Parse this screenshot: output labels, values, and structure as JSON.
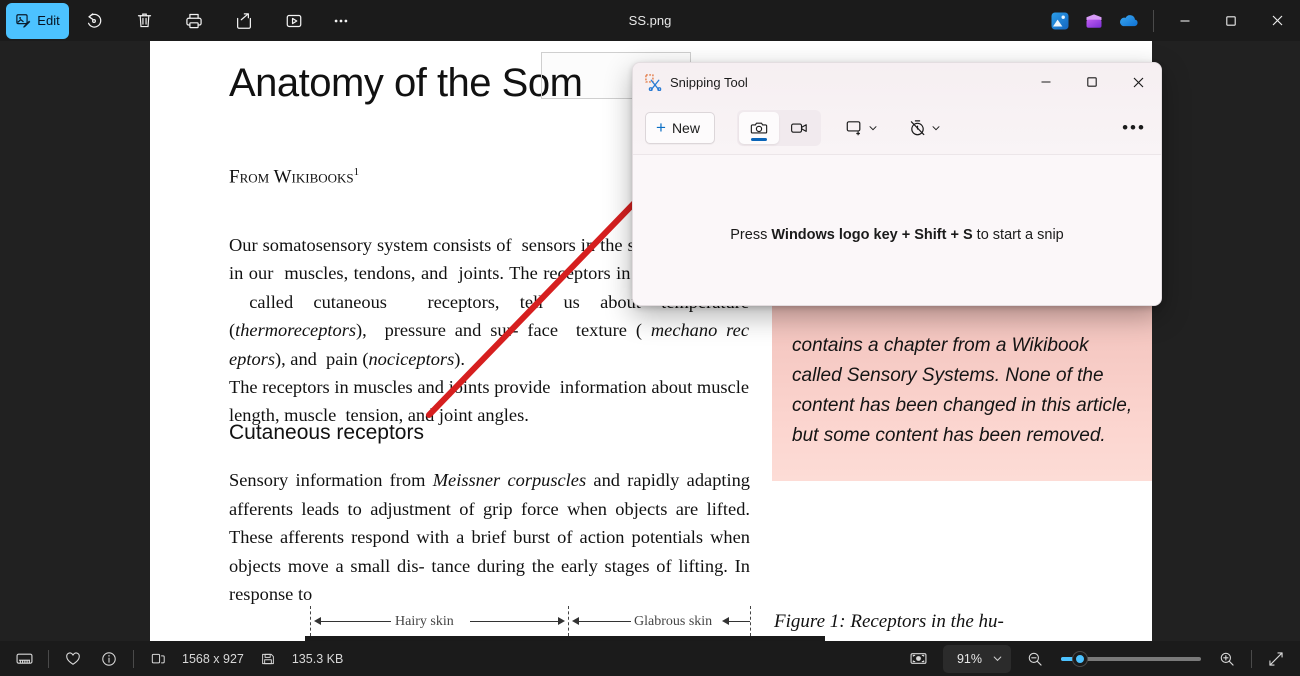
{
  "window": {
    "title": "SS.png",
    "edit_label": "Edit",
    "toolbar_icons": [
      "edit-image-icon",
      "rotate-icon",
      "delete-icon",
      "print-icon",
      "share-icon",
      "slideshow-icon",
      "more-options-icon"
    ],
    "app_shortcuts": [
      "photos-app-icon",
      "designer-app-icon",
      "onedrive-icon"
    ],
    "controls": {
      "minimize": "─",
      "maximize": "□",
      "close": "✕"
    }
  },
  "document": {
    "title": "Anatomy of the Som",
    "byline": "From Wikibooks",
    "byline_footnote": "1",
    "paragraph1": "Our somatosensory system consists of  sensors in the skin and sensors in our  muscles, tendons, and  joints. The receptors in the skin, the so  called cutaneous  receptors, tell us about temperature (thermoreceptors),  pressure and sur- face  texture ( mechano rec eptors), and  pain (nociceptors).",
    "paragraph1_extra": "The receptors in muscles and joints provide  information about muscle length, muscle  tension, and joint angles.",
    "section_heading": "Cutaneous receptors",
    "paragraph2": "Sensory information from Meissner corpuscles and rapidly adapting afferents leads to adjustment of grip force when objects are lifted. These afferents respond with a brief burst of action potentials when objects move a small dis-tance during the early stages of lifting. In response to",
    "italic_phrases": [
      "thermoreceptors",
      "mechano rec eptors",
      "nociceptors",
      "Meissner corpuscles"
    ],
    "callout_text": "contains a chapter from a Wikibook called Sensory Systems. None of the content has been changed in this article, but some content has been removed.",
    "figure_caption": "Figure 1:  Receptors in the hu-",
    "diagram_labels": [
      "Hairy skin",
      "Glabrous skin"
    ],
    "callout_color": "#f2c3bd",
    "annotation_arrow_color": "#d61f1f"
  },
  "snipping_tool": {
    "title": "Snipping Tool",
    "app_icon": "snipping-tool-icon",
    "new_button": "New",
    "plus": "+",
    "mode_buttons": [
      {
        "name": "camera-icon",
        "label": "Snip",
        "active": true
      },
      {
        "name": "video-camera-icon",
        "label": "Record",
        "active": false
      }
    ],
    "snip_shape_dropdown": "rectangle-mode-icon",
    "delay_dropdown": "timer-off-icon",
    "more_options": "•••",
    "hint_prefix": "Press ",
    "hint_bold": "Windows logo key + Shift + S",
    "hint_suffix": " to start a snip",
    "controls": {
      "minimize": "─",
      "maximize": "□",
      "close": "✕"
    },
    "accent_color": "#0a64b8"
  },
  "statusbar": {
    "filmstrip_icon": "filmstrip-icon",
    "favorite_icon": "heart-icon",
    "info_icon": "info-icon",
    "dimensions_icon": "image-size-icon",
    "dimensions": "1568 x 927",
    "filesize_icon": "save-icon",
    "filesize": "135.3 KB",
    "fit_icon": "fit-to-window-icon",
    "zoom_level": "91%",
    "zoom_out_icon": "zoom-out-icon",
    "zoom_in_icon": "zoom-in-icon",
    "fullscreen_icon": "fullscreen-icon",
    "slider_percent": 12,
    "accent_color": "#4cc2ff"
  }
}
